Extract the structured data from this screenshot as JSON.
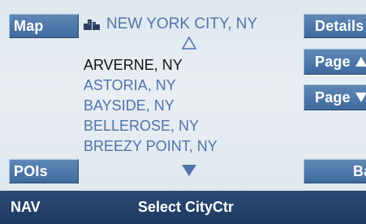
{
  "buttons": {
    "map": "Map",
    "pois": "POIs",
    "details": "Details",
    "page_up": "Page",
    "page_down": "Page",
    "back": "Back"
  },
  "header": {
    "title": "NEW YORK CITY, NY",
    "icon": "city-skyline-icon"
  },
  "list": {
    "items": [
      {
        "label": "ARVERNE, NY",
        "selected": true
      },
      {
        "label": "ASTORIA, NY",
        "selected": false
      },
      {
        "label": "BAYSIDE, NY",
        "selected": false
      },
      {
        "label": "BELLEROSE, NY",
        "selected": false
      },
      {
        "label": "BREEZY POINT, NY",
        "selected": false
      }
    ]
  },
  "status_bar": {
    "mode": "NAV",
    "screen_title": "Select CityCtr"
  },
  "colors": {
    "button": "#4f79aa",
    "list_text": "#4f73a8",
    "selected_text": "#111111",
    "status_bar": "#24426b"
  }
}
